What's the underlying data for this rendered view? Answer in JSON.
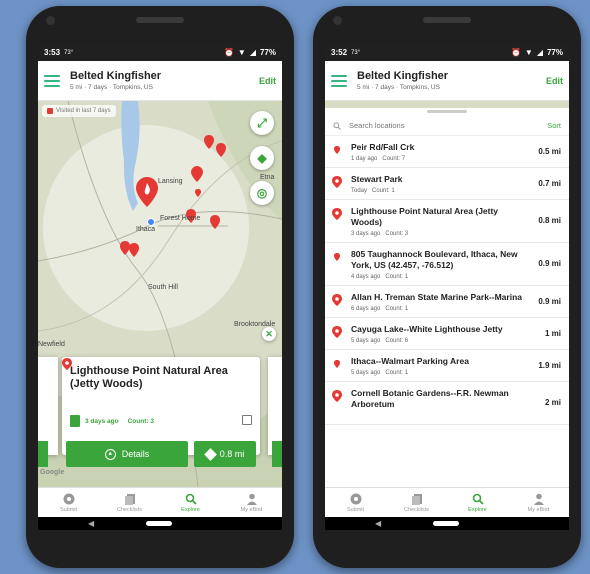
{
  "status": {
    "time": "3:53",
    "temp": "73°",
    "battery": "77%"
  },
  "status_right": {
    "time": "3:52",
    "temp": "73°",
    "battery": "77%"
  },
  "header": {
    "species": "Belted Kingfisher",
    "info": "5 mi · 7 days · Tompkins, US",
    "edit_label": "Edit"
  },
  "map": {
    "visited_label": "Visited in last 7 days",
    "labels": {
      "lansing": "Lansing",
      "etna": "Etna",
      "forest_home": "Forest Home",
      "ithaca": "Ithaca",
      "south_hill": "South Hill",
      "brooktondale": "Brooktondale",
      "newfield": "Newfield",
      "google": "Google"
    }
  },
  "location_card": {
    "title": "Lighthouse Point Natural Area (Jetty Woods)",
    "last_seen": "3 days ago",
    "count": "Count: 3",
    "details_label": "Details",
    "distance": "0.8 mi"
  },
  "search": {
    "placeholder": "Search locations",
    "sort_label": "Sort"
  },
  "locations": [
    {
      "name": "Peir Rd/Fall Crk",
      "when": "1 day ago",
      "count": "Count: 7",
      "distance": "0.5 mi",
      "icon": "small-pin-icon"
    },
    {
      "name": "Stewart Park",
      "when": "Today",
      "count": "Count: 1",
      "distance": "0.7 mi",
      "icon": "hotspot-pin-icon"
    },
    {
      "name": "Lighthouse Point Natural Area (Jetty Woods)",
      "when": "3 days ago",
      "count": "Count: 3",
      "distance": "0.8 mi",
      "icon": "hotspot-pin-icon"
    },
    {
      "name": "805 Taughannock Boulevard, Ithaca, New York, US (42.457, -76.512)",
      "when": "4 days ago",
      "count": "Count: 1",
      "distance": "0.9 mi",
      "icon": "small-pin-icon"
    },
    {
      "name": "Allan H. Treman State Marine Park--Marina",
      "when": "6 days ago",
      "count": "Count: 1",
      "distance": "0.9 mi",
      "icon": "hotspot-pin-icon"
    },
    {
      "name": "Cayuga Lake--White Lighthouse Jetty",
      "when": "5 days ago",
      "count": "Count: 6",
      "distance": "1 mi",
      "icon": "hotspot-pin-icon"
    },
    {
      "name": "Ithaca--Walmart Parking Area",
      "when": "5 days ago",
      "count": "Count: 1",
      "distance": "1.9 mi",
      "icon": "small-pin-icon"
    },
    {
      "name": "Cornell Botanic Gardens--F.R. Newman Arboretum",
      "when": "",
      "count": "",
      "distance": "2 mi",
      "icon": "hotspot-pin-icon"
    }
  ],
  "nav": [
    {
      "label": "Submit",
      "icon": "submit-icon"
    },
    {
      "label": "Checklists",
      "icon": "checklists-icon"
    },
    {
      "label": "Explore",
      "icon": "explore-icon"
    },
    {
      "label": "My eBird",
      "icon": "profile-icon"
    }
  ],
  "colors": {
    "accent": "#3aa53a",
    "pin": "#e53935",
    "lake": "#a7c8e8",
    "background": "#6d93c6"
  }
}
